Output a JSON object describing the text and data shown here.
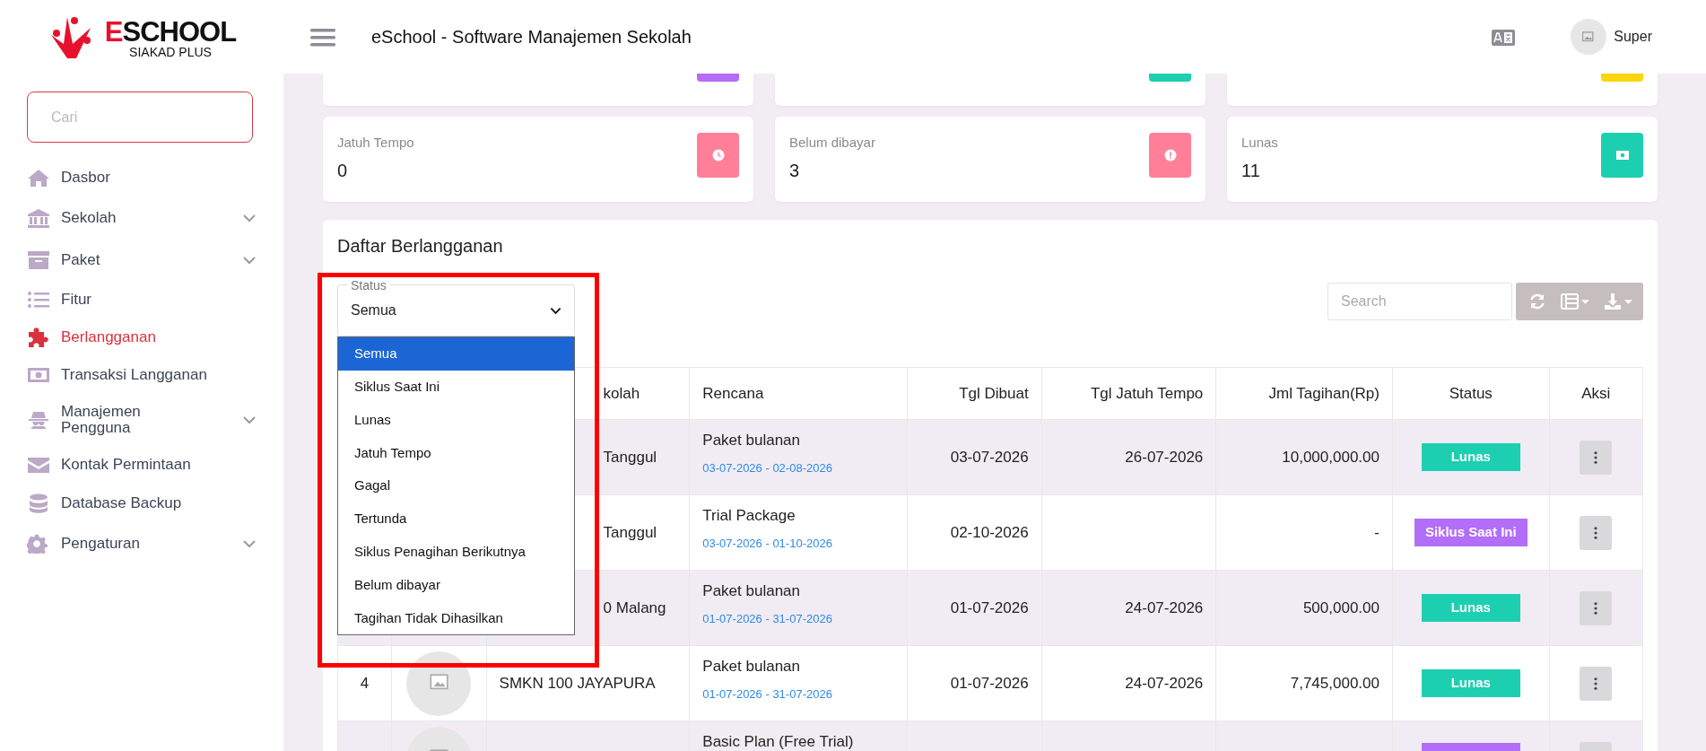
{
  "brand": {
    "name": "ESCHOOL",
    "tagline": "SIAKAD PLUS"
  },
  "sidebar": {
    "search": {
      "placeholder": "Cari"
    },
    "items": [
      {
        "label": "Dasbor",
        "has_submenu": false,
        "selected": false
      },
      {
        "label": "Sekolah",
        "has_submenu": true,
        "selected": false
      },
      {
        "label": "Paket",
        "has_submenu": true,
        "selected": false
      },
      {
        "label": "Fitur",
        "has_submenu": false,
        "selected": false
      },
      {
        "label": "Berlangganan",
        "has_submenu": false,
        "selected": true
      },
      {
        "label": "Transaksi Langganan",
        "has_submenu": false,
        "selected": false
      },
      {
        "label": "Manajemen Pengguna",
        "has_submenu": true,
        "selected": false
      },
      {
        "label": "Kontak Permintaan",
        "has_submenu": false,
        "selected": false
      },
      {
        "label": "Database Backup",
        "has_submenu": false,
        "selected": false
      },
      {
        "label": "Pengaturan",
        "has_submenu": true,
        "selected": false
      }
    ]
  },
  "header": {
    "title": "eSchool - Software Manajemen Sekolah",
    "user": "Super"
  },
  "stat_cards_scrolled": [
    {
      "color": "#b56cf6"
    },
    {
      "color": "#1ccfb0"
    },
    {
      "color": "#fcd50c"
    }
  ],
  "stat_cards": [
    {
      "label": "Jatuh Tempo",
      "value": "0",
      "color": "#ff7f98"
    },
    {
      "label": "Belum dibayar",
      "value": "3",
      "color": "#ff7f98"
    },
    {
      "label": "Lunas",
      "value": "11",
      "color": "#1ccfb0"
    }
  ],
  "subscriptions": {
    "title": "Daftar Berlangganan",
    "status_filter": {
      "label": "Status",
      "value": "Semua",
      "options": [
        {
          "label": "Semua",
          "selected": true
        },
        {
          "label": "Siklus Saat Ini",
          "selected": false
        },
        {
          "label": "Lunas",
          "selected": false
        },
        {
          "label": "Jatuh Tempo",
          "selected": false
        },
        {
          "label": "Gagal",
          "selected": false
        },
        {
          "label": "Tertunda",
          "selected": false
        },
        {
          "label": "Siklus Penagihan Berikutnya",
          "selected": false
        },
        {
          "label": "Belum dibayar",
          "selected": false
        },
        {
          "label": "Tagihan Tidak Dihasilkan",
          "selected": false
        }
      ]
    },
    "search": {
      "placeholder": "Search"
    },
    "table": {
      "columns": [
        "kolah",
        "Rencana",
        "Tgl Dibuat",
        "Tgl Jatuh Tempo",
        "Jml Tagihan(Rp)",
        "Status",
        "Aksi"
      ],
      "rows": [
        {
          "name": "Tanggul",
          "plan": "Paket bulanan",
          "period": "03-07-2026 - 02-08-2026",
          "created": "03-07-2026",
          "due": "26-07-2026",
          "amount": "10,000,000.00",
          "status": {
            "kind": "paid",
            "label": "Lunas"
          }
        },
        {
          "name": "Tanggul",
          "plan": "Trial Package",
          "period": "03-07-2026 - 01-10-2026",
          "created": "02-10-2026",
          "amount": "-",
          "status": {
            "kind": "current",
            "label": "Siklus Saat Ini"
          }
        },
        {
          "name": "0 Malang",
          "plan": "Paket bulanan",
          "period": "01-07-2026 - 31-07-2026",
          "created": "01-07-2026",
          "due": "24-07-2026",
          "amount": "500,000.00",
          "status": {
            "kind": "paid",
            "label": "Lunas"
          }
        },
        {
          "no": "4",
          "name": "SMKN 100 JAYAPURA",
          "plan": "Paket bulanan",
          "period": "01-07-2026 - 31-07-2026",
          "created": "01-07-2026",
          "due": "24-07-2026",
          "amount": "7,745,000.00",
          "status": {
            "kind": "paid",
            "label": "Lunas"
          }
        },
        {
          "plan": "Basic Plan (Free Trial)",
          "status": {
            "kind": "current"
          }
        }
      ]
    }
  }
}
